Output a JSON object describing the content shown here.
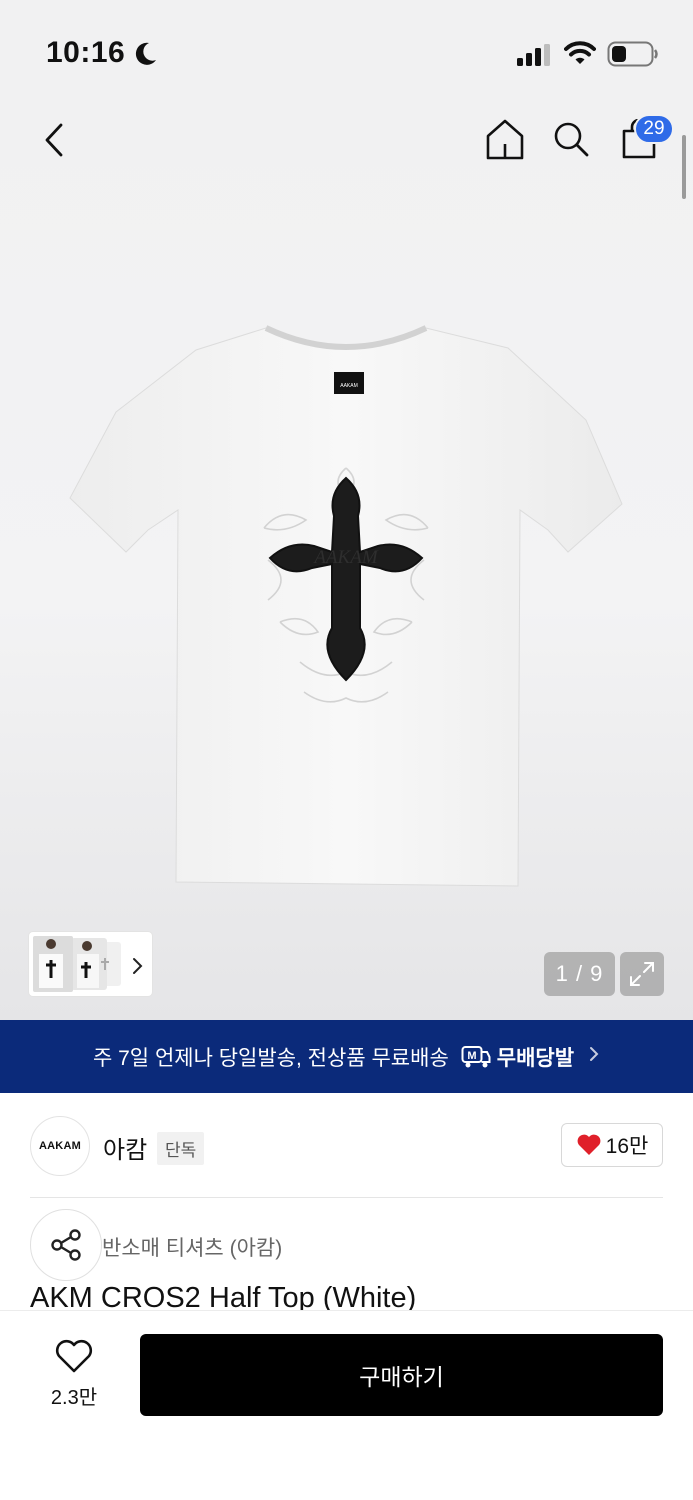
{
  "status_bar": {
    "time": "10:16",
    "icons": [
      "moon-icon",
      "signal-icon",
      "wifi-icon",
      "battery-icon"
    ]
  },
  "top_nav": {
    "icons": [
      "back-icon",
      "home-icon",
      "search-icon",
      "cart-icon"
    ],
    "cart_count": "29"
  },
  "gallery": {
    "counter": "1 / 9",
    "icons": [
      "chevron-right-icon",
      "expand-icon"
    ]
  },
  "banner": {
    "text": "주 7일 언제나 당일발송, 전상품 무료배송",
    "logo_text": "무배당발",
    "icons": [
      "delivery-truck-icon",
      "chevron-right-icon"
    ]
  },
  "brand": {
    "logo_text": "AAKAM",
    "name": "아캄",
    "tag": "단독",
    "likes": "16만",
    "icons": [
      "heart-filled-icon"
    ]
  },
  "product": {
    "category": "반소매 티셔츠 (아캄)",
    "title": "AKM CROS2 Half Top (White)",
    "label_text": "AAKAM",
    "print_text": "AAKAM",
    "icons": [
      "share-icon"
    ]
  },
  "bottom_bar": {
    "wish_count": "2.3만",
    "buy_label": "구매하기",
    "icons": [
      "heart-outline-icon"
    ]
  },
  "colors": {
    "banner_bg": "#0b2a7a",
    "badge_bg": "#2f6be8",
    "heart_red": "#e0202a",
    "buy_bg": "#000000"
  }
}
